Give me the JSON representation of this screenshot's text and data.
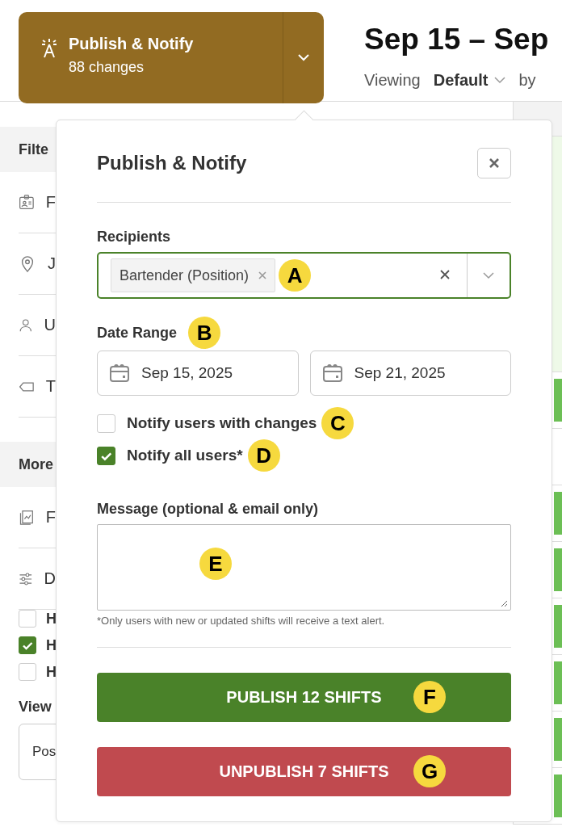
{
  "publish_button": {
    "title": "Publish & Notify",
    "subtitle": "88 changes"
  },
  "header": {
    "title": "Sep 15 – Sep",
    "viewing_label": "Viewing",
    "view_value": "Default",
    "by_label": "by"
  },
  "sidebar": {
    "sections": [
      {
        "title": "Filte",
        "items": [
          {
            "label": "F"
          },
          {
            "label": "J"
          },
          {
            "label": "U"
          },
          {
            "label": "T"
          }
        ]
      },
      {
        "title": "More",
        "items": [
          {
            "label": "F"
          },
          {
            "label": "D"
          }
        ]
      }
    ],
    "checkboxes": [
      {
        "label": "H",
        "checked": false
      },
      {
        "label": "H",
        "checked": true
      },
      {
        "label": "H",
        "checked": false
      }
    ],
    "view": {
      "label": "View",
      "value": "Pos"
    }
  },
  "schedule_rows": [
    {
      "kind": "header"
    },
    {
      "kind": "highlight"
    },
    {
      "kind": "shift"
    },
    {
      "kind": "empty"
    },
    {
      "kind": "shift"
    },
    {
      "kind": "shift"
    },
    {
      "kind": "shift"
    },
    {
      "kind": "shift"
    },
    {
      "kind": "shift"
    },
    {
      "kind": "shift"
    }
  ],
  "popover": {
    "title": "Publish & Notify",
    "recipients": {
      "label": "Recipients",
      "chips": [
        {
          "text": "Bartender (Position)"
        }
      ],
      "callout": "A"
    },
    "date_range": {
      "label": "Date Range",
      "callout": "B",
      "start": "Sep 15, 2025",
      "end": "Sep 21, 2025"
    },
    "options": [
      {
        "label": "Notify users with changes",
        "checked": false,
        "callout": "C"
      },
      {
        "label": "Notify all users*",
        "checked": true,
        "callout": "D"
      }
    ],
    "message": {
      "label": "Message (optional & email only)",
      "callout": "E",
      "note": "*Only users with new or updated shifts will receive a text alert."
    },
    "actions": [
      {
        "kind": "publish",
        "label": "PUBLISH 12 SHIFTS",
        "callout": "F"
      },
      {
        "kind": "unpublish",
        "label": "UNPUBLISH 7 SHIFTS",
        "callout": "G"
      }
    ]
  }
}
